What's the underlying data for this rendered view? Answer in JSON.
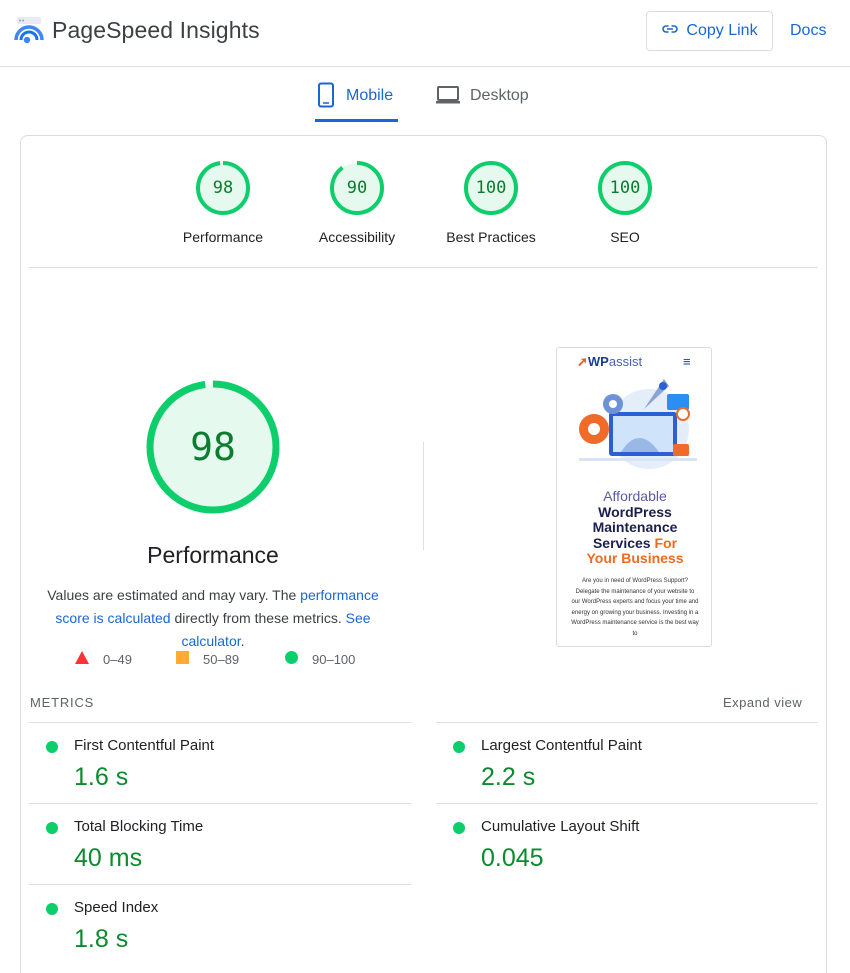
{
  "header": {
    "app_title": "PageSpeed Insights",
    "copy_link_label": "Copy Link",
    "docs_label": "Docs"
  },
  "tabs": [
    {
      "label": "Mobile",
      "active": true
    },
    {
      "label": "Desktop",
      "active": false
    }
  ],
  "scores": [
    {
      "value": "98",
      "label": "Performance"
    },
    {
      "value": "90",
      "label": "Accessibility"
    },
    {
      "value": "100",
      "label": "Best Practices"
    },
    {
      "value": "100",
      "label": "SEO"
    }
  ],
  "performance": {
    "score": "98",
    "title": "Performance",
    "desc_prefix": "Values are estimated and may vary. The ",
    "desc_link1": "performance score is calculated",
    "desc_middle": " directly from these metrics. ",
    "desc_link2": "See calculator",
    "desc_suffix": "."
  },
  "legend": [
    {
      "range": "0–49",
      "shape": "triangle",
      "color": "#ff3333"
    },
    {
      "range": "50–89",
      "shape": "square",
      "color": "#ffaa33"
    },
    {
      "range": "90–100",
      "shape": "circle",
      "color": "#0cce6b"
    }
  ],
  "thumbnail": {
    "logo_a": "WP",
    "logo_b": "assist",
    "heading_line1": "Affordable",
    "heading_line2": "WordPress",
    "heading_line3": "Maintenance",
    "heading_line4a": "Services ",
    "heading_line4b": "For",
    "heading_line5": "Your Business",
    "body_text": "Are you in need of WordPress Support? Delegate the maintenance of your website to our WordPress experts and focus your time and energy on growing your business. Investing in a WordPress maintenance service is the best way to"
  },
  "metrics": {
    "title": "METRICS",
    "expand_label": "Expand view",
    "items": [
      {
        "name": "First Contentful Paint",
        "value": "1.6 s"
      },
      {
        "name": "Largest Contentful Paint",
        "value": "2.2 s"
      },
      {
        "name": "Total Blocking Time",
        "value": "40 ms"
      },
      {
        "name": "Cumulative Layout Shift",
        "value": "0.045"
      },
      {
        "name": "Speed Index",
        "value": "1.8 s"
      }
    ]
  },
  "colors": {
    "accent": "#1967d2",
    "pass_green": "#0cce6b",
    "pass_text": "#0b7d2f"
  }
}
